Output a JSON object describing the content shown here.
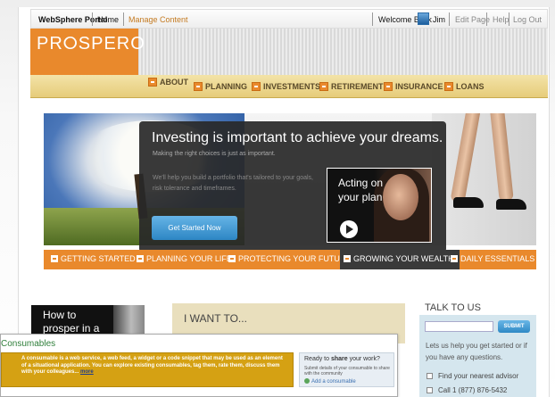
{
  "topbar": {
    "portal": "WebSphere Portal",
    "home": "Home",
    "manage": "Manage Content",
    "welcome": "Welcome Back",
    "user": "Jim",
    "edit_page": "Edit Page",
    "help": "Help",
    "logout": "Log Out"
  },
  "logo": {
    "text": "PR⭘SPERO"
  },
  "nav": {
    "items": [
      {
        "label": "ABOUT"
      },
      {
        "label": "PLANNING"
      },
      {
        "label": "INVESTMENTS"
      },
      {
        "label": "RETIREMENT"
      },
      {
        "label": "INSURANCE"
      },
      {
        "label": "LOANS"
      }
    ]
  },
  "promo": {
    "title": "Investing is important to achieve your dreams.",
    "subtitle": "Making the right choices is just as important.",
    "body": "We'll help you build a portfolio that's tailored to your goals, risk tolerance and timeframes.",
    "button": "Get Started Now",
    "video_text": "Acting on your plan"
  },
  "subnav": {
    "items": [
      {
        "label": "GETTING STARTED"
      },
      {
        "label": "PLANNING YOUR LIFE"
      },
      {
        "label": "PROTECTING YOUR FUTURE"
      },
      {
        "label": "GROWING YOUR WEALTH"
      },
      {
        "label": "DAILY ESSENTIALS"
      }
    ]
  },
  "howto": {
    "text": "How to prosper in a"
  },
  "iwant": {
    "title": "I WANT TO..."
  },
  "talk": {
    "title": "TALK TO US",
    "submit": "SUBMIT",
    "text": "Lets us help you get started or if you have any questions.",
    "link_advisor": "Find your nearest advisor",
    "link_call": "Call 1 (877) 876-5432"
  },
  "consumables": {
    "title": "Consumables",
    "description": "A consumable is a web service, a web feed, a widget or a code snippet that may be used as an element of a situational application. You can explore existing consumables, tag them, rate them, discuss them with your colleagues...",
    "more": "more",
    "ready_prefix": "Ready to",
    "ready_emph": "share",
    "ready_suffix": "your work?",
    "ready_sub": "Submit details of your consumable to share with the community",
    "add": "Add a consumable"
  },
  "colors": {
    "brand_orange": "#e9892c",
    "nav_band": "#ebd48a",
    "consumable_box": "#d5a113",
    "talk_panel": "#d5e6ee"
  }
}
